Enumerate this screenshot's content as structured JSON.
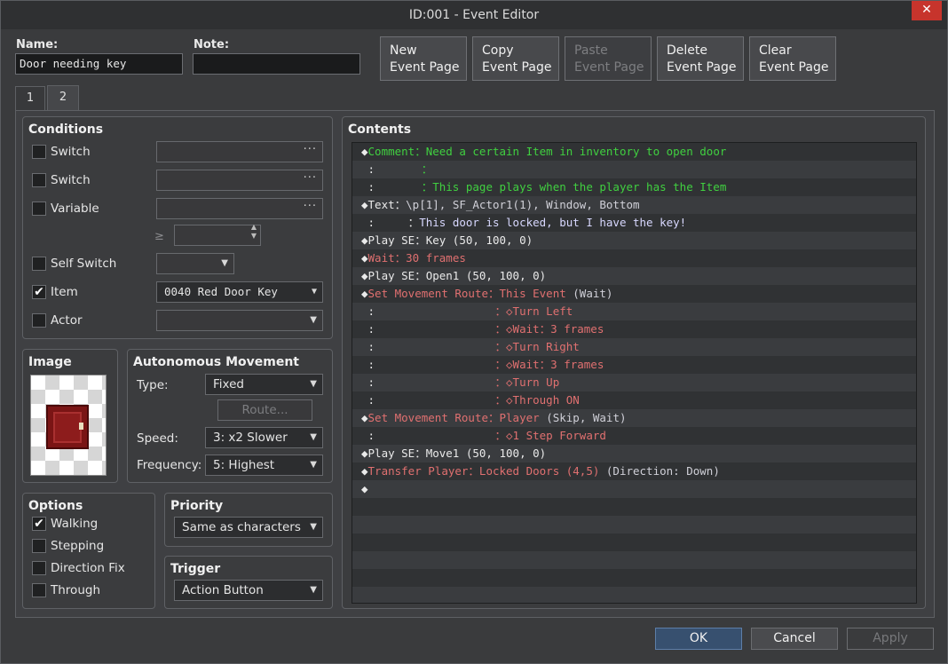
{
  "window": {
    "title": "ID:001 - Event Editor",
    "close_glyph": "✕"
  },
  "name": {
    "label": "Name:",
    "value": "Door needing key"
  },
  "note": {
    "label": "Note:",
    "value": ""
  },
  "page_buttons": [
    {
      "line1": "New",
      "line2": "Event Page",
      "enabled": true
    },
    {
      "line1": "Copy",
      "line2": "Event Page",
      "enabled": true
    },
    {
      "line1": "Paste",
      "line2": "Event Page",
      "enabled": false
    },
    {
      "line1": "Delete",
      "line2": "Event Page",
      "enabled": true
    },
    {
      "line1": "Clear",
      "line2": "Event Page",
      "enabled": true
    }
  ],
  "tabs": [
    {
      "label": "1"
    },
    {
      "label": "2",
      "active": true
    }
  ],
  "conditions": {
    "title": "Conditions",
    "switch1": {
      "label": "Switch",
      "checked": false,
      "value": "",
      "glyph": "···"
    },
    "switch2": {
      "label": "Switch",
      "checked": false,
      "value": "",
      "glyph": "···"
    },
    "variable": {
      "label": "Variable",
      "checked": false,
      "value": "",
      "glyph": "···",
      "ge": "≥",
      "number": ""
    },
    "self_switch": {
      "label": "Self Switch",
      "checked": false,
      "value": ""
    },
    "item": {
      "label": "Item",
      "checked": true,
      "value": "0040 Red Door Key"
    },
    "actor": {
      "label": "Actor",
      "checked": false,
      "value": ""
    }
  },
  "image": {
    "title": "Image"
  },
  "autonomous": {
    "title": "Autonomous Movement",
    "type_label": "Type:",
    "type_value": "Fixed",
    "route_label": "Route...",
    "speed_label": "Speed:",
    "speed_value": "3: x2 Slower",
    "frequency_label": "Frequency:",
    "frequency_value": "5: Highest"
  },
  "options": {
    "title": "Options",
    "items": [
      {
        "label": "Walking",
        "checked": true
      },
      {
        "label": "Stepping",
        "checked": false
      },
      {
        "label": "Direction Fix",
        "checked": false
      },
      {
        "label": "Through",
        "checked": false
      }
    ]
  },
  "priority": {
    "title": "Priority",
    "value": "Same as characters"
  },
  "trigger": {
    "title": "Trigger",
    "value": "Action Button"
  },
  "contents": {
    "title": "Contents",
    "lines": [
      [
        {
          "t": "◆",
          "c": "white"
        },
        {
          "t": "Comment：Need a certain Item in inventory to open door",
          "c": "green"
        }
      ],
      [
        {
          "t": " :       ",
          "c": "white"
        },
        {
          "t": "：",
          "c": "green"
        }
      ],
      [
        {
          "t": " :       ",
          "c": "white"
        },
        {
          "t": "：This page plays when the player has the Item",
          "c": "green"
        }
      ],
      [
        {
          "t": "◆Text：",
          "c": "white"
        },
        {
          "t": "\\p[1], SF_Actor1(1), Window, Bottom",
          "c": "lt"
        }
      ],
      [
        {
          "t": " :     ：",
          "c": "white"
        },
        {
          "t": "This door is locked, but I have the key!",
          "c": "blue"
        }
      ],
      [
        {
          "t": "◆Play SE：Key (50, 100, 0)",
          "c": "white"
        }
      ],
      [
        {
          "t": "◆",
          "c": "white"
        },
        {
          "t": "Wait：30 frames",
          "c": "red"
        }
      ],
      [
        {
          "t": "◆Play SE：Open1 (50, 100, 0)",
          "c": "white"
        }
      ],
      [
        {
          "t": "◆",
          "c": "white"
        },
        {
          "t": "Set Movement Route：This Event ",
          "c": "red"
        },
        {
          "t": "(Wait)",
          "c": "lt"
        }
      ],
      [
        {
          "t": " :                  ",
          "c": "white"
        },
        {
          "t": "：◇Turn Left",
          "c": "red"
        }
      ],
      [
        {
          "t": " :                  ",
          "c": "white"
        },
        {
          "t": "：◇",
          "c": "red"
        },
        {
          "t": "Wait：3 frames",
          "c": "red"
        }
      ],
      [
        {
          "t": " :                  ",
          "c": "white"
        },
        {
          "t": "：◇Turn Right",
          "c": "red"
        }
      ],
      [
        {
          "t": " :                  ",
          "c": "white"
        },
        {
          "t": "：◇",
          "c": "red"
        },
        {
          "t": "Wait：3 frames",
          "c": "red"
        }
      ],
      [
        {
          "t": " :                  ",
          "c": "white"
        },
        {
          "t": "：◇Turn Up",
          "c": "red"
        }
      ],
      [
        {
          "t": " :                  ",
          "c": "white"
        },
        {
          "t": "：◇Through ON",
          "c": "red"
        }
      ],
      [
        {
          "t": "◆",
          "c": "white"
        },
        {
          "t": "Set Movement Route：Player ",
          "c": "red"
        },
        {
          "t": "(Skip, Wait)",
          "c": "lt"
        }
      ],
      [
        {
          "t": " :                  ",
          "c": "white"
        },
        {
          "t": "：◇1 Step Forward",
          "c": "red"
        }
      ],
      [
        {
          "t": "◆Play SE：Move1 (50, 100, 0)",
          "c": "white"
        }
      ],
      [
        {
          "t": "◆",
          "c": "white"
        },
        {
          "t": "Transfer Player：Locked Doors (4,5) ",
          "c": "red"
        },
        {
          "t": "(Direction: Down)",
          "c": "lt"
        }
      ],
      [
        {
          "t": "◆",
          "c": "white"
        }
      ]
    ]
  },
  "footer": {
    "ok": "OK",
    "cancel": "Cancel",
    "apply": "Apply"
  }
}
